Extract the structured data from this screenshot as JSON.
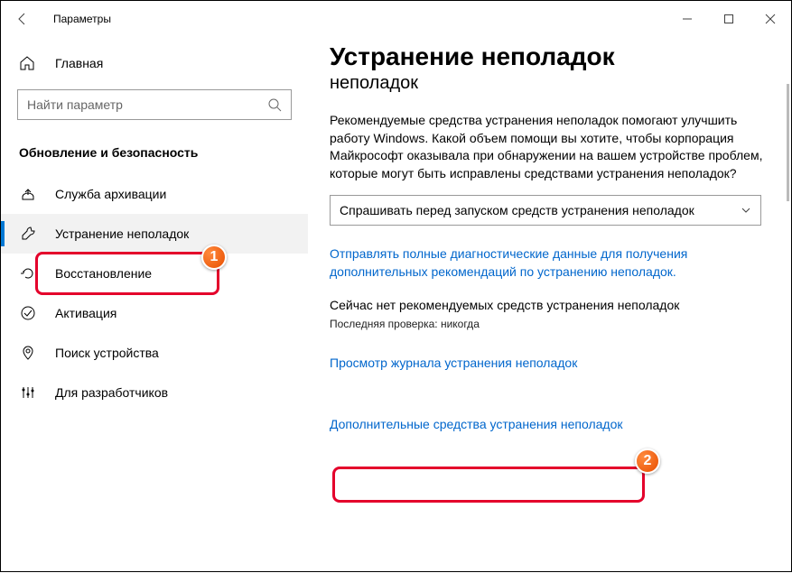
{
  "titlebar": {
    "title": "Параметры"
  },
  "sidebar": {
    "home": "Главная",
    "search_placeholder": "Найти параметр",
    "section": "Обновление и безопасность",
    "items": [
      {
        "label": "Служба архивации"
      },
      {
        "label": "Устранение неполадок"
      },
      {
        "label": "Восстановление"
      },
      {
        "label": "Активация"
      },
      {
        "label": "Поиск устройства"
      },
      {
        "label": "Для разработчиков"
      }
    ]
  },
  "main": {
    "heading": "Устранение неполадок",
    "subheading": "неполадок",
    "intro": "Рекомендуемые средства устранения неполадок помогают улучшить работу Windows. Какой объем помощи вы хотите, чтобы корпорация Майкрософт оказывала при обнаружении на вашем устройстве проблем, которые могут быть исправлены средствами устранения неполадок?",
    "dropdown_value": "Спрашивать перед запуском средств устранения неполадок",
    "diag_link": "Отправлять полные диагностические данные для получения дополнительных рекомендаций по устранению неполадок.",
    "status": "Сейчас нет рекомендуемых средств устранения неполадок",
    "last_check": "Последняя проверка: никогда",
    "history_link": "Просмотр журнала устранения неполадок",
    "additional_link": "Дополнительные средства устранения неполадок"
  },
  "annotations": {
    "badge1": "1",
    "badge2": "2"
  }
}
